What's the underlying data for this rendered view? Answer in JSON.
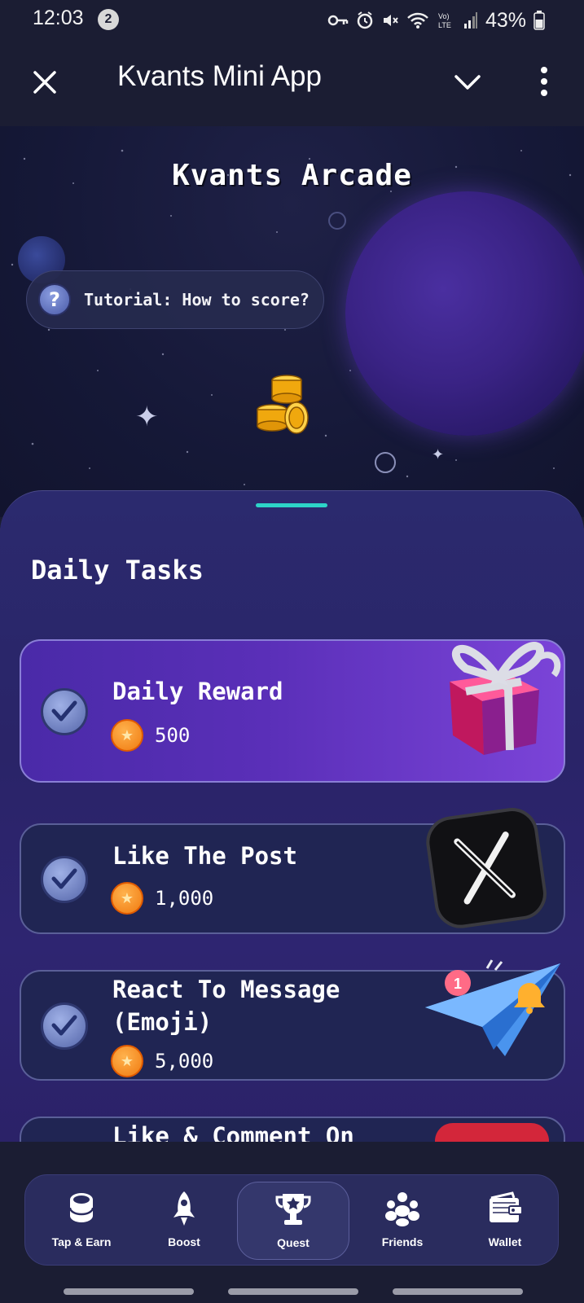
{
  "status_bar": {
    "time": "12:03",
    "notification_count": "2",
    "icons": [
      "key-icon",
      "alarm-icon",
      "mute-icon",
      "wifi-icon",
      "volte-icon",
      "signal-icon"
    ],
    "battery_percent": "43%"
  },
  "header": {
    "title": "Kvants Mini App",
    "close_icon": "close-icon",
    "collapse_icon": "chevron-down-icon",
    "menu_icon": "more-vertical-icon"
  },
  "hero": {
    "title": "Kvants Arcade",
    "tutorial_label": "Tutorial: How to score?"
  },
  "section": {
    "title": "Daily Tasks"
  },
  "tasks": [
    {
      "name": "Daily Reward",
      "reward": "500",
      "art": "gift-box",
      "highlighted": true
    },
    {
      "name": "Like The Post",
      "reward": "1,000",
      "art": "x-logo",
      "highlighted": false
    },
    {
      "name": "React To Message (Emoji)",
      "name_lines": [
        "React To Message",
        "(Emoji)"
      ],
      "reward": "5,000",
      "art": "telegram-plane",
      "highlighted": false
    },
    {
      "name": "Like & Comment On",
      "art": "red-badge",
      "highlighted": false
    }
  ],
  "nav": {
    "items": [
      {
        "label": "Tap & Earn",
        "icon": "coin-stack-icon",
        "active": false
      },
      {
        "label": "Boost",
        "icon": "rocket-icon",
        "active": false
      },
      {
        "label": "Quest",
        "icon": "trophy-icon",
        "active": true
      },
      {
        "label": "Friends",
        "icon": "friends-icon",
        "active": false
      },
      {
        "label": "Wallet",
        "icon": "wallet-icon",
        "active": false
      }
    ]
  },
  "colors": {
    "background": "#1b1d33",
    "sheet": "#2a2468",
    "accent_teal": "#2dd4c8",
    "coin": "#f07a10"
  }
}
